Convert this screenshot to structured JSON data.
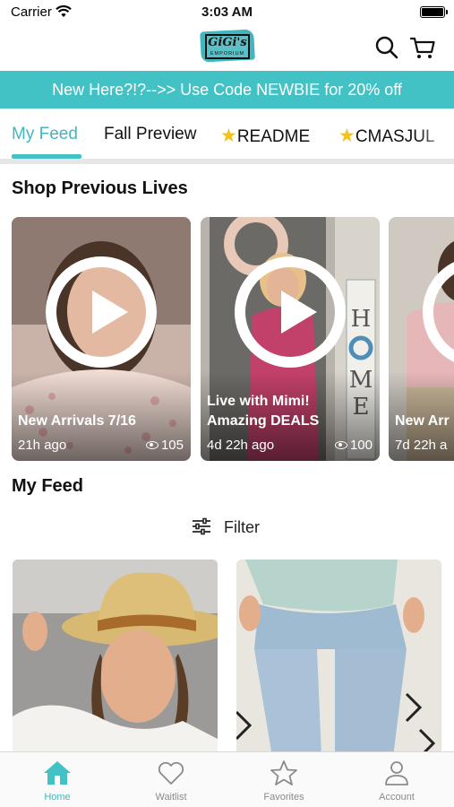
{
  "status_bar": {
    "carrier": "Carrier",
    "time": "3:03 AM"
  },
  "header": {
    "logo_text": "GiGi's",
    "logo_subtext": "EMPORIUM",
    "search_icon": "search-icon",
    "cart_icon": "cart-icon"
  },
  "promo": {
    "text": "New Here?!?-->> Use Code NEWBIE for 20% off"
  },
  "tabs": [
    {
      "label": "My Feed",
      "active": true
    },
    {
      "label": "Fall Preview",
      "active": false
    },
    {
      "label": "README",
      "active": false,
      "icon": "star-icon"
    },
    {
      "label": "CMASJUL",
      "active": false,
      "icon": "star-icon"
    }
  ],
  "shop_previous_lives": {
    "title": "Shop Previous Lives",
    "items": [
      {
        "title": "New Arrivals 7/16",
        "time": "21h ago",
        "views": "105"
      },
      {
        "title_line1": "Live with Mimi!",
        "title_line2": "Amazing DEALS",
        "time": "4d 22h ago",
        "views": "100"
      },
      {
        "title": "New Arr",
        "time": "7d 22h a"
      }
    ]
  },
  "my_feed": {
    "title": "My Feed",
    "filter_label": "Filter"
  },
  "bottom_nav": [
    {
      "label": "Home",
      "icon": "home-icon",
      "active": true
    },
    {
      "label": "Waitlist",
      "icon": "heart-icon",
      "active": false
    },
    {
      "label": "Favorites",
      "icon": "star-icon",
      "active": false
    },
    {
      "label": "Account",
      "icon": "account-icon",
      "active": false
    }
  ],
  "colors": {
    "accent": "#42c2c5",
    "accent_text": "#42b7bd",
    "star": "#f2c21a",
    "nav_inactive": "#8a8a8a"
  }
}
